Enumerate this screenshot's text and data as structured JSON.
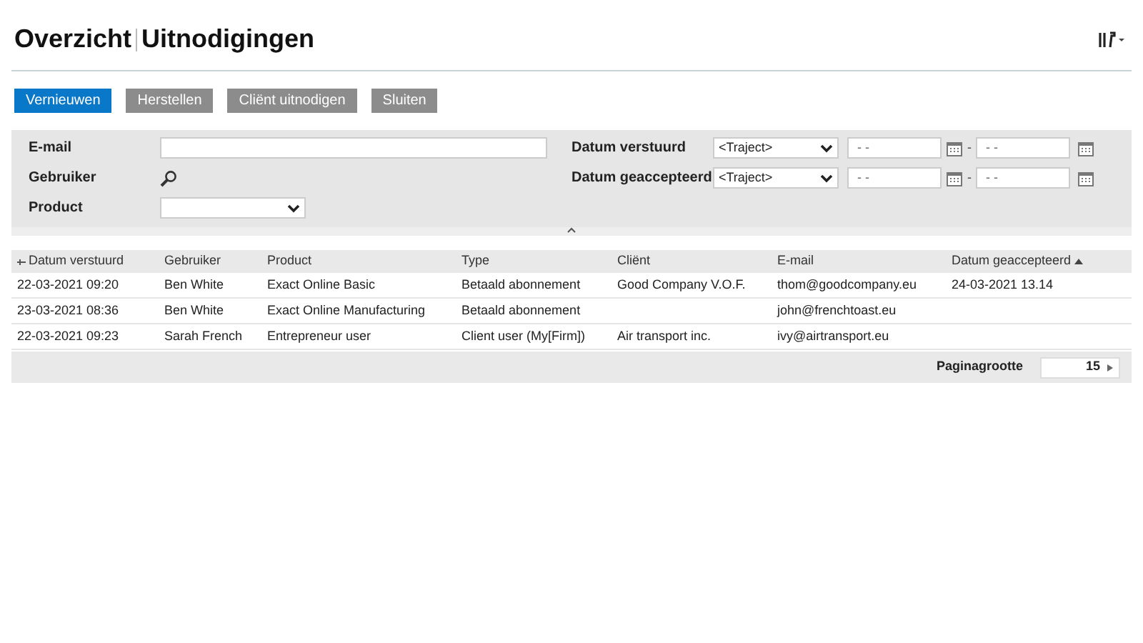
{
  "header": {
    "title": "Overzicht",
    "subtitle": "Uitnodigingen"
  },
  "buttons": [
    {
      "label": "Vernieuwen",
      "primary": true
    },
    {
      "label": "Herstellen",
      "primary": false
    },
    {
      "label": "Cliënt uitnodigen",
      "primary": false
    },
    {
      "label": "Sluiten",
      "primary": false
    }
  ],
  "filters": {
    "email": {
      "label": "E-mail"
    },
    "user": {
      "label": "Gebruiker"
    },
    "product": {
      "label": "Product"
    },
    "dates": [
      {
        "label": "Datum verstuurd",
        "range": "<Traject>",
        "from": "- -",
        "separator": "-",
        "to": "- -"
      },
      {
        "label": "Datum geaccepteerd",
        "range": "<Traject>",
        "from": "- -",
        "separator": "-",
        "to": "- -"
      }
    ]
  },
  "table": {
    "columns": [
      {
        "label": "Datum verstuurd",
        "pinned": true,
        "sorted": false
      },
      {
        "label": "Gebruiker",
        "pinned": false,
        "sorted": false
      },
      {
        "label": "Product",
        "pinned": false,
        "sorted": false
      },
      {
        "label": "Type",
        "pinned": false,
        "sorted": false
      },
      {
        "label": "Cliënt",
        "pinned": false,
        "sorted": false
      },
      {
        "label": "E-mail",
        "pinned": false,
        "sorted": false
      },
      {
        "label": "Datum geaccepteerd",
        "pinned": false,
        "sorted": true
      }
    ],
    "rows": [
      [
        "22-03-2021 09:20",
        "Ben White",
        "Exact Online Basic",
        "Betaald abonnement",
        "Good Company V.O.F.",
        "thom@goodcompany.eu",
        "24-03-2021 13.14"
      ],
      [
        "23-03-2021 08:36",
        "Ben White",
        "Exact Online Manufacturing",
        "Betaald abonnement",
        "",
        "john@frenchtoast.eu",
        ""
      ],
      [
        "22-03-2021 09:23",
        "Sarah French",
        "Entrepreneur user",
        "Client user (My[Firm])",
        "Air transport inc.",
        "ivy@airtransport.eu",
        ""
      ]
    ]
  },
  "footer": {
    "label": "Paginagrootte",
    "page_size": "15"
  }
}
